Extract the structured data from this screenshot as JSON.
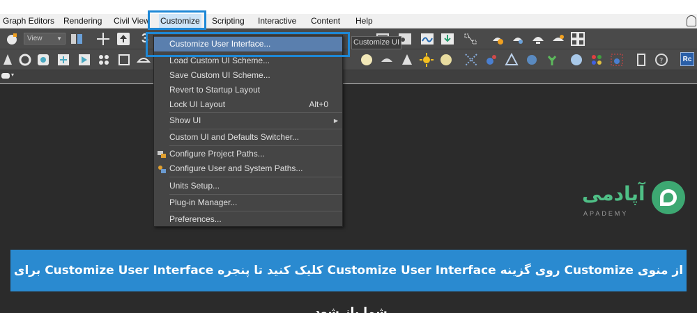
{
  "menubar": {
    "items": [
      {
        "label": "Graph Editors"
      },
      {
        "label": "Rendering"
      },
      {
        "label": "Civil View"
      },
      {
        "label": "Customize"
      },
      {
        "label": "Scripting"
      },
      {
        "label": "Interactive"
      },
      {
        "label": "Content"
      },
      {
        "label": "Help"
      }
    ]
  },
  "toolbar": {
    "view_dropdown": "View",
    "three_label": "3",
    "rc_badge": "Rc"
  },
  "customize_menu": {
    "items": [
      {
        "label": "Customize User Interface...",
        "shortcut": ""
      },
      {
        "label": "Load Custom UI Scheme...",
        "shortcut": ""
      },
      {
        "label": "Save Custom UI Scheme...",
        "shortcut": ""
      },
      {
        "label": "Revert to Startup Layout",
        "shortcut": ""
      },
      {
        "label": "Lock UI Layout",
        "shortcut": "Alt+0"
      },
      {
        "label": "Show UI",
        "shortcut": ""
      },
      {
        "label": "Custom UI and Defaults Switcher...",
        "shortcut": ""
      },
      {
        "label": "Configure Project Paths...",
        "shortcut": ""
      },
      {
        "label": "Configure User and System Paths...",
        "shortcut": ""
      },
      {
        "label": "Units Setup...",
        "shortcut": ""
      },
      {
        "label": "Plug-in Manager...",
        "shortcut": ""
      },
      {
        "label": "Preferences...",
        "shortcut": ""
      }
    ]
  },
  "tooltip": "Customize UI",
  "logo": {
    "text": "آپادمی",
    "sub": "APADEMY"
  },
  "caption": "از منوی Customize روی گزینه Customize User Interface کلیک کنید تا پنجره Customize User Interface برای شما باز شود.",
  "colors": {
    "highlight_border": "#1e88d6",
    "caption_bg": "#2a8ad0",
    "menu_highlight": "#5a7fae",
    "logo_green": "#3da872"
  }
}
